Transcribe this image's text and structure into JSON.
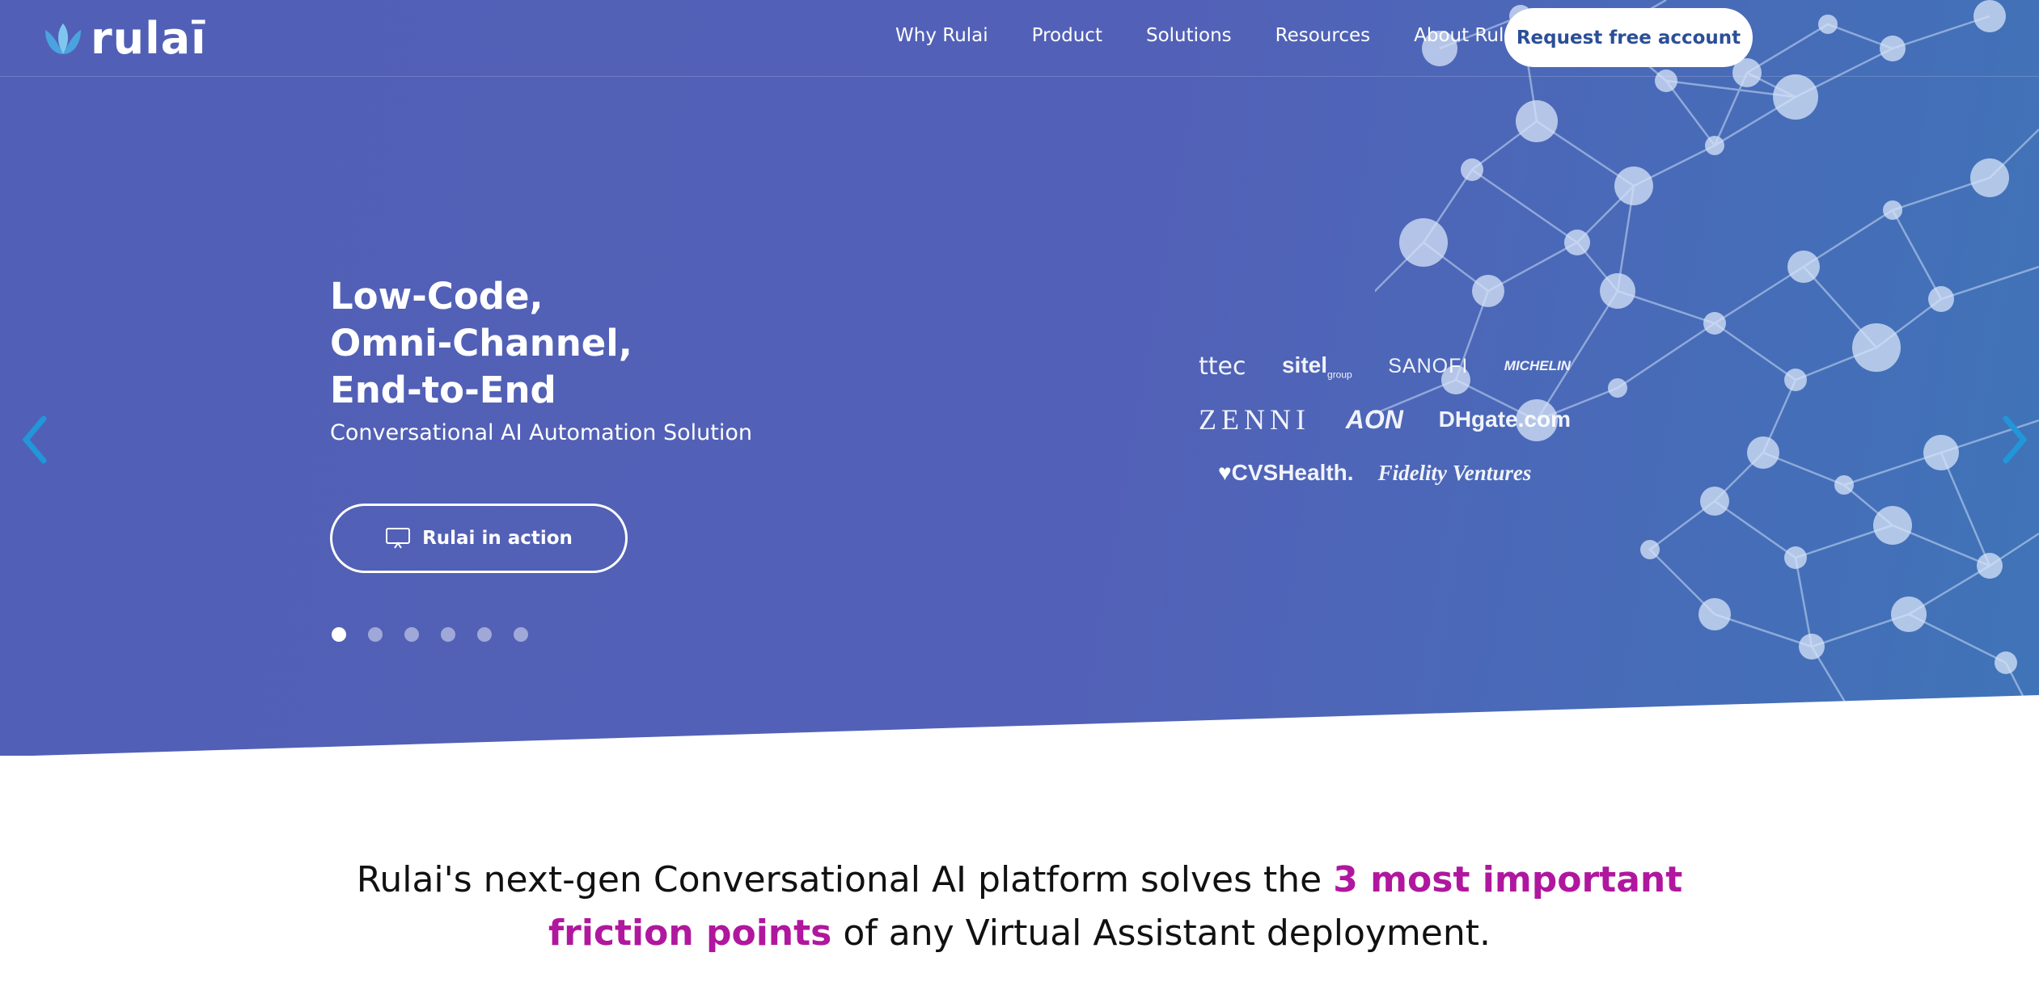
{
  "header": {
    "logo_text": "rulaī",
    "nav": [
      "Why Rulai",
      "Product",
      "Solutions",
      "Resources",
      "About Rulai"
    ],
    "cta_label": "Request free account"
  },
  "hero": {
    "headline": [
      "Low-Code,",
      "Omni-Channel,",
      "End-to-End"
    ],
    "subhead": "Conversational AI Automation Solution",
    "action_label": "Rulai in action",
    "slide_count": 6,
    "active_slide": 1,
    "client_logos": [
      [
        "ttec",
        "sitel",
        "SANOFI",
        "MICHELIN"
      ],
      [
        "ZENNI",
        "AON",
        "DHgate.com"
      ],
      [
        "CVSHealth.",
        "Fidelity Ventures"
      ]
    ],
    "sitel_sub": "group"
  },
  "tagline": {
    "part1": "Rulai's next-gen Conversational AI platform solves the ",
    "highlight1": "3 most important",
    "highlight2": "friction points",
    "part2": " of any Virtual Assistant deployment."
  },
  "colors": {
    "hero_bg": "#5160b6",
    "accent": "#b0179e",
    "cta_text": "#2b4f97",
    "arrow": "#2196d8"
  },
  "icons": [
    "lotus-logo-icon",
    "presentation-icon",
    "chevron-left-icon",
    "chevron-right-icon"
  ]
}
